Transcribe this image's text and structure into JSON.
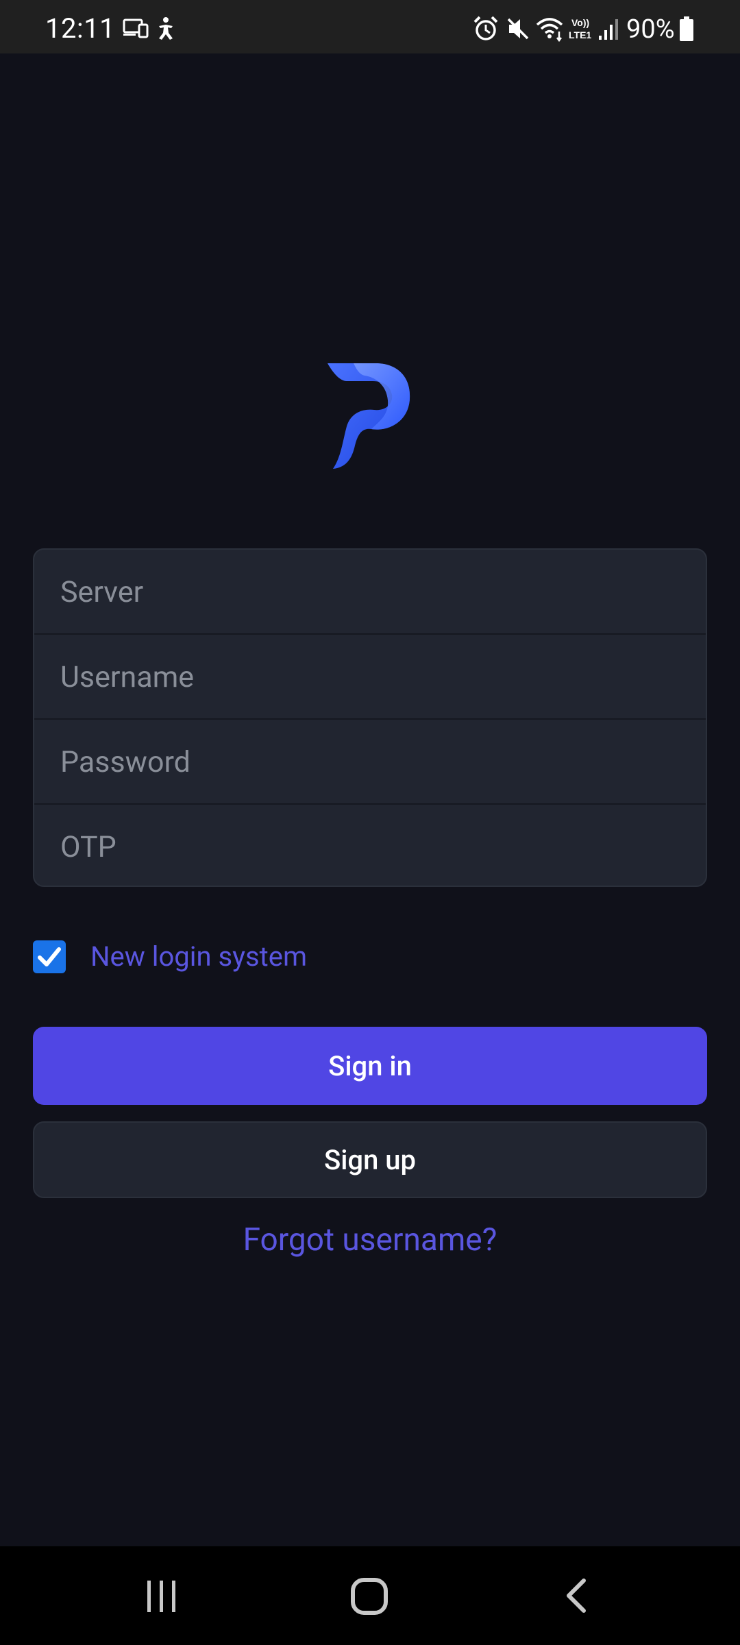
{
  "status_bar": {
    "time": "12:11",
    "battery_percent": "90%",
    "icons": [
      "screen-cast-icon",
      "accessibility-icon",
      "alarm-icon",
      "mute-icon",
      "wifi-icon",
      "volte-lte-icon",
      "signal-icon",
      "battery-icon"
    ],
    "volte_label": "Vo)) LTE1"
  },
  "app": {
    "logo": "P",
    "brand_colors": {
      "logo_light": "#6b8cff",
      "logo_dark": "#2f5bff"
    }
  },
  "form": {
    "server_placeholder": "Server",
    "username_placeholder": "Username",
    "password_placeholder": "Password",
    "otp_placeholder": "OTP"
  },
  "checkbox": {
    "label": "New login system",
    "checked": true
  },
  "buttons": {
    "signin_label": "Sign in",
    "signup_label": "Sign up"
  },
  "links": {
    "forgot_username": "Forgot username?"
  },
  "colors": {
    "background": "#10111a",
    "accent": "#5046e4",
    "link": "#5a56e0",
    "checkbox": "#1a73e8"
  },
  "nav_bar": {
    "icons": [
      "recents-icon",
      "home-icon",
      "back-icon"
    ]
  }
}
